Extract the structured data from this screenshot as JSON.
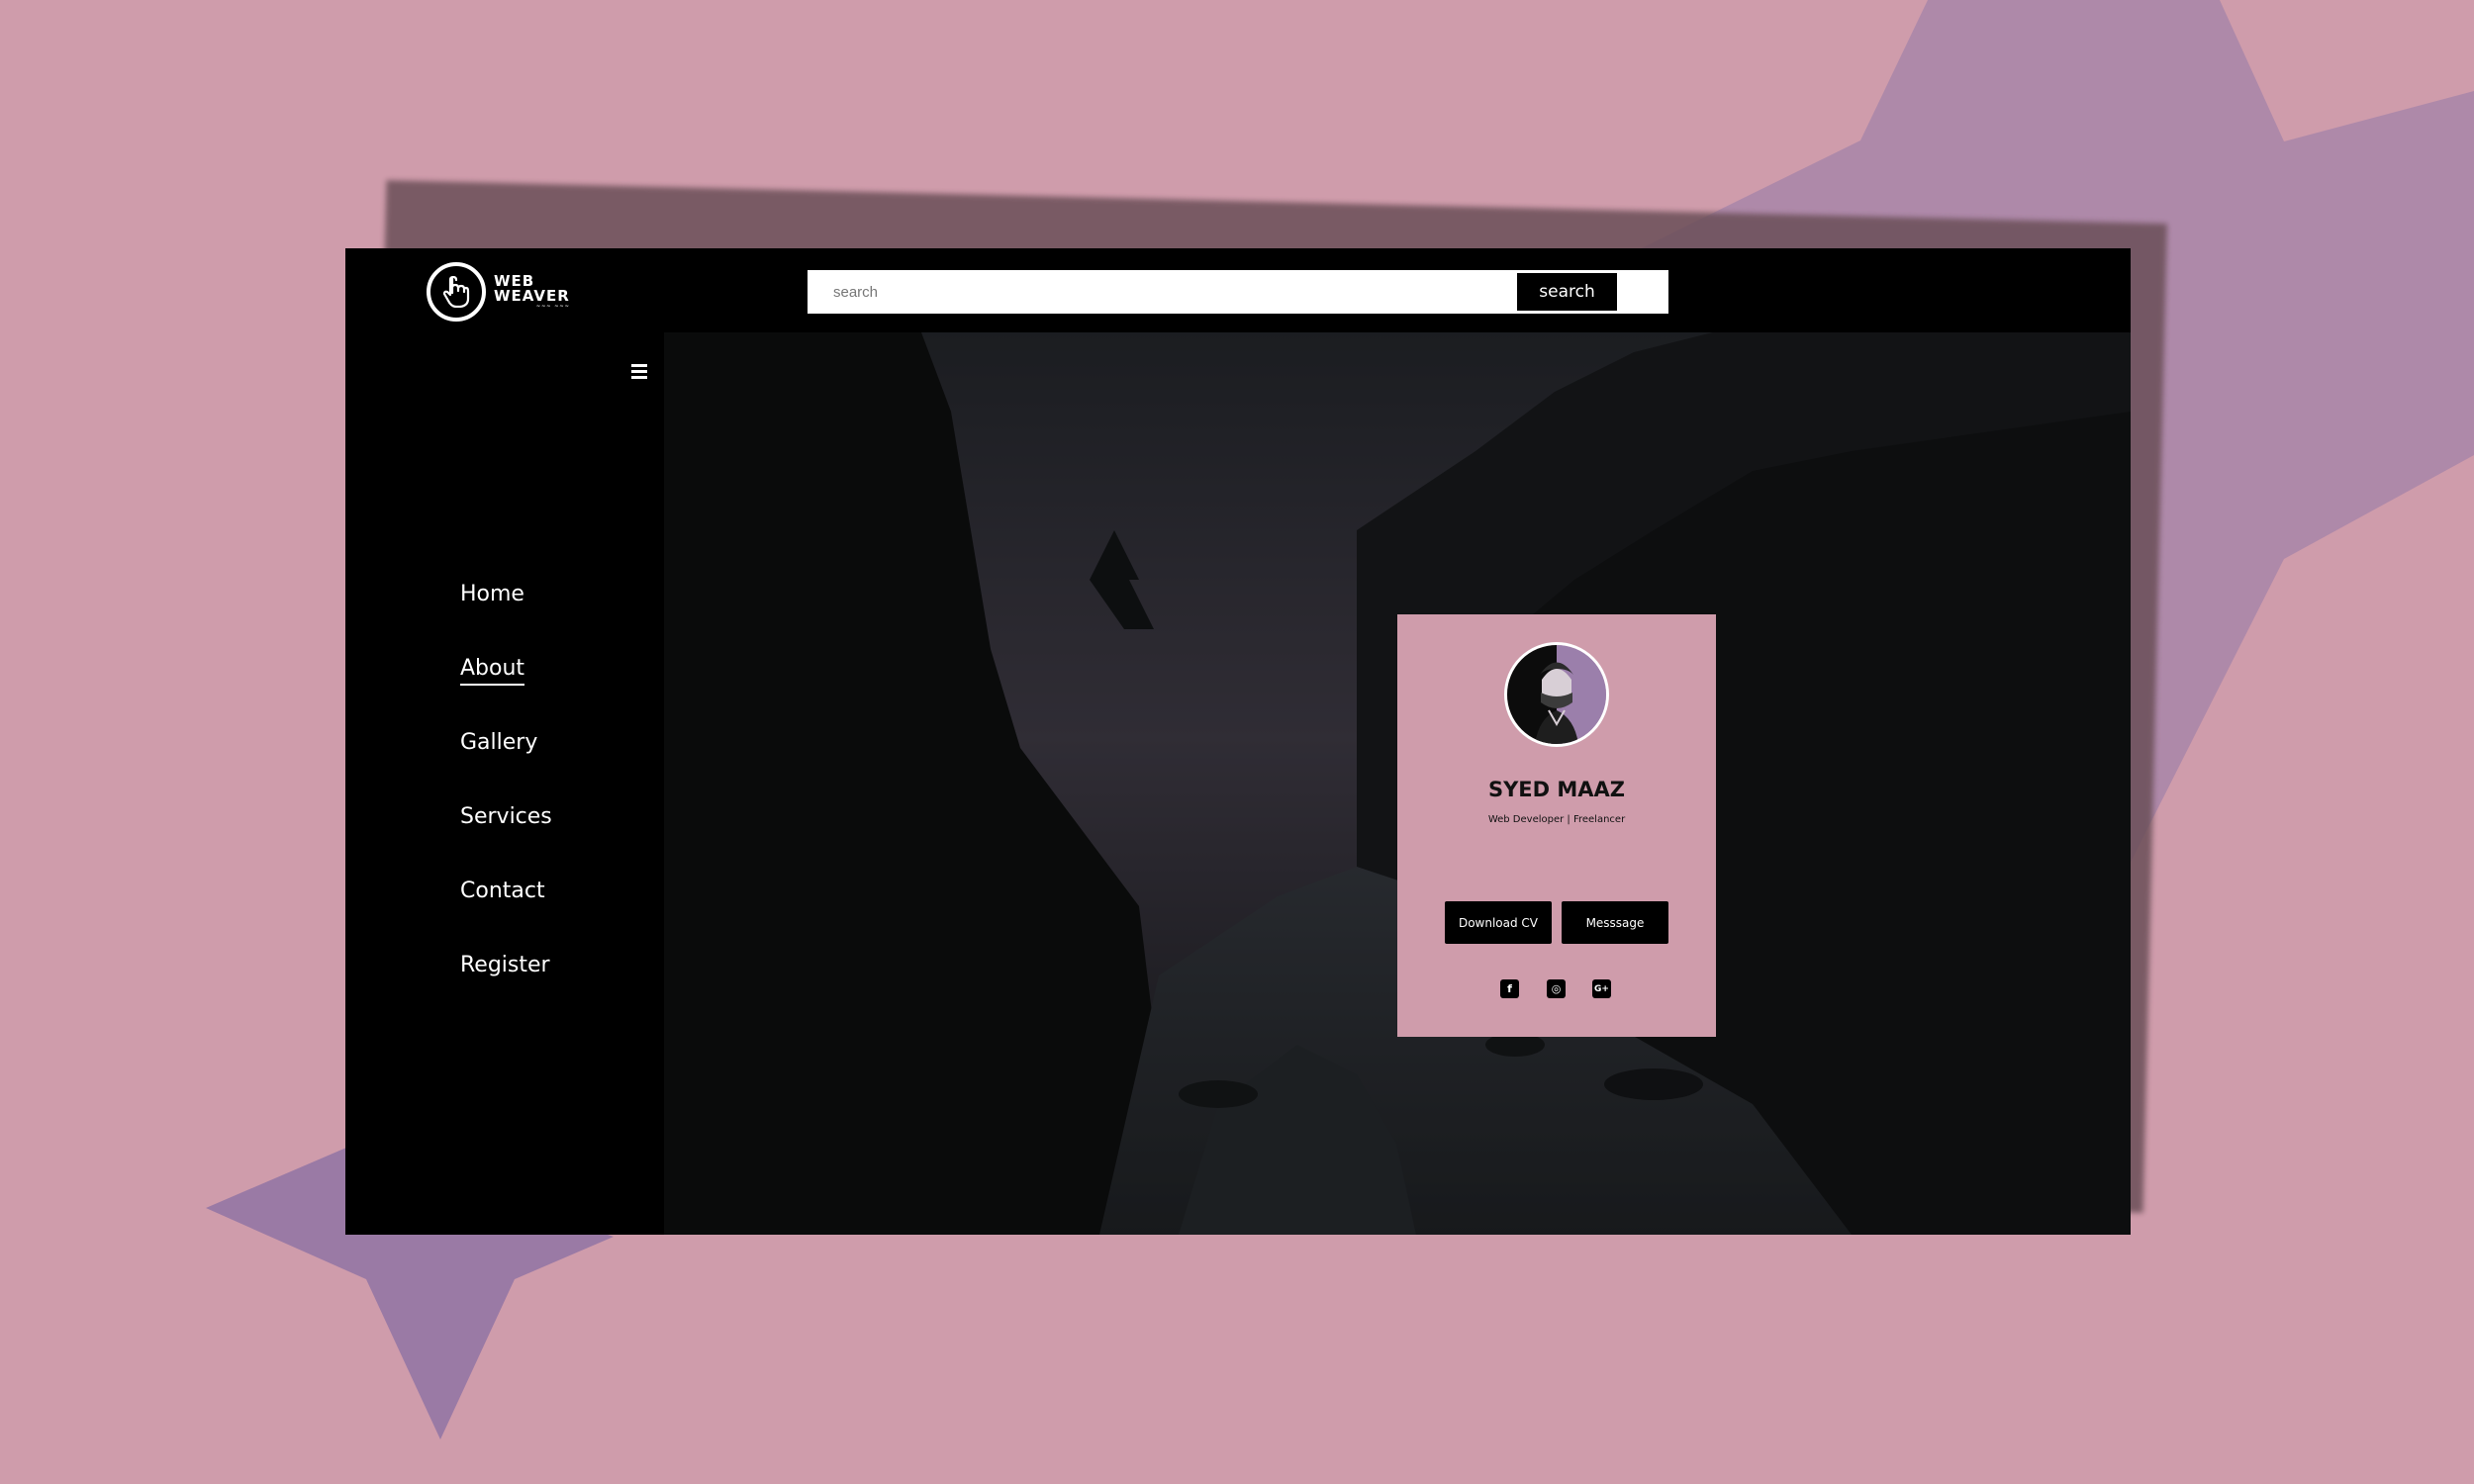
{
  "brand": {
    "logo_text_line1": "WEB",
    "logo_text_line2": "WEAVER",
    "logo_icon": "pointing-hand-icon"
  },
  "search": {
    "placeholder": "search",
    "button_label": "search"
  },
  "sidebar": {
    "menu_icon": "hamburger-icon",
    "items": [
      {
        "label": "Home",
        "active": false
      },
      {
        "label": "About",
        "active": true
      },
      {
        "label": "Gallery",
        "active": false
      },
      {
        "label": "Services",
        "active": false
      },
      {
        "label": "Contact",
        "active": false
      },
      {
        "label": "Register",
        "active": false
      }
    ]
  },
  "profile": {
    "name": "SYED MAAZ",
    "role": "Web Developer | Freelancer",
    "buttons": {
      "download": "Download CV",
      "message": "Messsage"
    },
    "socials": [
      {
        "icon": "facebook-icon",
        "glyph": "f"
      },
      {
        "icon": "instagram-icon",
        "glyph": "◎"
      },
      {
        "icon": "google-plus-icon",
        "glyph": "G+"
      }
    ]
  },
  "colors": {
    "page_background": "#cf9cab",
    "star_accent": "#9b7fab",
    "window": "#000000",
    "card": "#cf9cab"
  }
}
